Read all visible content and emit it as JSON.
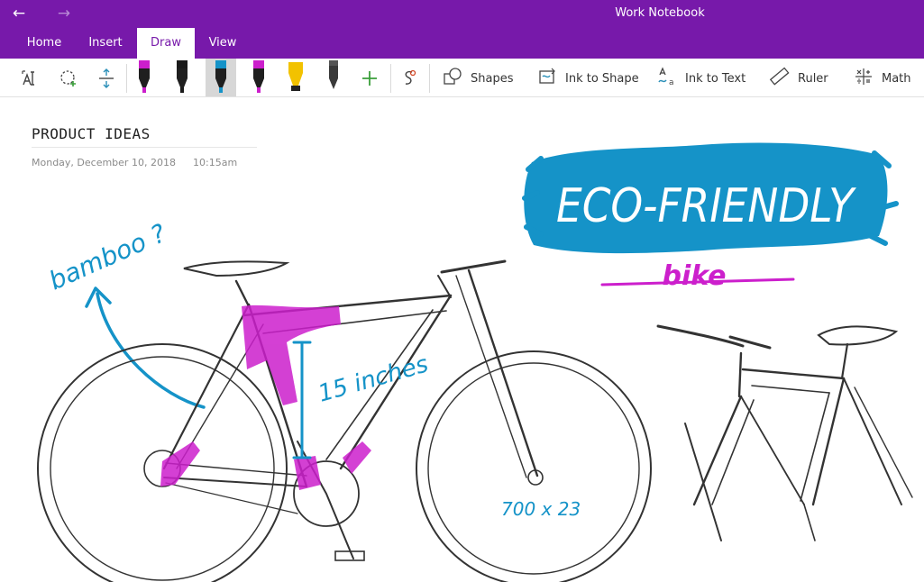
{
  "app": {
    "title": "Work Notebook"
  },
  "tabs": [
    {
      "label": "Home"
    },
    {
      "label": "Insert"
    },
    {
      "label": "Draw"
    },
    {
      "label": "View"
    }
  ],
  "active_tab": "Draw",
  "ribbon": {
    "tools": [
      {
        "icon": "type-select-icon"
      },
      {
        "icon": "lasso-select-icon"
      },
      {
        "icon": "add-space-icon"
      }
    ],
    "pens": [
      {
        "icon": "pen-icon",
        "color": "#cc1fcc"
      },
      {
        "icon": "pen-icon",
        "color": "#1a1a1a"
      },
      {
        "icon": "pen-icon",
        "color": "#1593c8"
      },
      {
        "icon": "pen-icon",
        "color": "#cc1fcc"
      },
      {
        "icon": "highlighter-icon",
        "color": "#f2c200"
      },
      {
        "icon": "pencil-icon",
        "color": "#555555"
      }
    ],
    "selected_pen": 2,
    "commands": [
      {
        "label": "Shapes",
        "icon": "shapes-icon"
      },
      {
        "label": "Ink to Shape",
        "icon": "ink-to-shape-icon"
      },
      {
        "label": "Ink to Text",
        "icon": "ink-to-text-icon"
      },
      {
        "label": "Ruler",
        "icon": "ruler-icon"
      },
      {
        "label": "Math",
        "icon": "math-icon"
      }
    ]
  },
  "page": {
    "title": "PRODUCT IDEAS",
    "date": "Monday, December 10, 2018",
    "time": "10:15am"
  },
  "ink": {
    "headline": "ECO-FRIENDLY",
    "subhead": "bike",
    "note_material": "bamboo ?",
    "note_measure": "15 inches",
    "note_wheel": "700 x 23"
  },
  "colors": {
    "accent": "#7719aa",
    "ink_blue": "#1593c8",
    "ink_magenta": "#cc1fcc"
  }
}
